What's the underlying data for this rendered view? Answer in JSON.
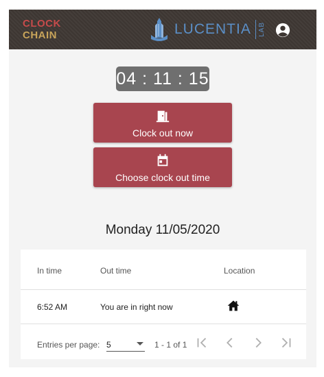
{
  "header": {
    "logo_line1": "CLOCK",
    "logo_line2": "CHAIN",
    "brand": "LUCENTIA",
    "brand_sub": "LAB",
    "account_icon": "account-circle-icon"
  },
  "timer": {
    "value": "04 : 11 : 15"
  },
  "actions": {
    "clock_out_now": {
      "label": "Clock out now",
      "icon": "door-icon"
    },
    "choose_time": {
      "label": "Choose clock out time",
      "icon": "calendar-icon"
    }
  },
  "date_heading": "Monday 11/05/2020",
  "table": {
    "columns": [
      "In time",
      "Out time",
      "Location"
    ],
    "rows": [
      {
        "in_time": "6:52 AM",
        "out_time": "You are in right now",
        "location_icon": "home-icon"
      }
    ]
  },
  "pagination": {
    "entries_label": "Entries per page:",
    "per_page": "5",
    "range": "1 - 1 of 1",
    "buttons": [
      "first-page-icon",
      "previous-page-icon",
      "next-page-icon",
      "last-page-icon"
    ]
  },
  "colors": {
    "topbar": "#3d3632",
    "button": "#a8454f",
    "timer_bg": "#6f6f6f",
    "brand_blue": "#5b8fc7"
  }
}
